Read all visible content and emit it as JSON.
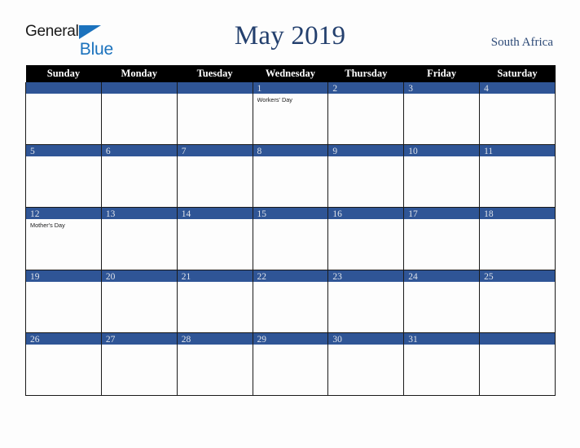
{
  "brand": {
    "word_one": "General",
    "word_two": "Blue",
    "flag_icon": "blue-triangle-flag-icon",
    "accent_color": "#1b72bd"
  },
  "header": {
    "title": "May 2019",
    "region": "South Africa",
    "title_color": "#24406e",
    "region_color": "#2d4a77"
  },
  "colors": {
    "day_header_bg": "#000000",
    "day_header_text": "#ffffff",
    "date_bar_bg": "#2f5596",
    "date_number_text": "#dfe3ea",
    "cell_bg": "#fdfdfd",
    "grid_line": "#1a1a1a",
    "page_bg": "#fdfdfd"
  },
  "weekday_headers": [
    "Sunday",
    "Monday",
    "Tuesday",
    "Wednesday",
    "Thursday",
    "Friday",
    "Saturday"
  ],
  "weeks": [
    [
      {
        "date": "",
        "events": []
      },
      {
        "date": "",
        "events": []
      },
      {
        "date": "",
        "events": []
      },
      {
        "date": "1",
        "events": [
          "Workers' Day"
        ]
      },
      {
        "date": "2",
        "events": []
      },
      {
        "date": "3",
        "events": []
      },
      {
        "date": "4",
        "events": []
      }
    ],
    [
      {
        "date": "5",
        "events": []
      },
      {
        "date": "6",
        "events": []
      },
      {
        "date": "7",
        "events": []
      },
      {
        "date": "8",
        "events": []
      },
      {
        "date": "9",
        "events": []
      },
      {
        "date": "10",
        "events": []
      },
      {
        "date": "11",
        "events": []
      }
    ],
    [
      {
        "date": "12",
        "events": [
          "Mother's Day"
        ]
      },
      {
        "date": "13",
        "events": []
      },
      {
        "date": "14",
        "events": []
      },
      {
        "date": "15",
        "events": []
      },
      {
        "date": "16",
        "events": []
      },
      {
        "date": "17",
        "events": []
      },
      {
        "date": "18",
        "events": []
      }
    ],
    [
      {
        "date": "19",
        "events": []
      },
      {
        "date": "20",
        "events": []
      },
      {
        "date": "21",
        "events": []
      },
      {
        "date": "22",
        "events": []
      },
      {
        "date": "23",
        "events": []
      },
      {
        "date": "24",
        "events": []
      },
      {
        "date": "25",
        "events": []
      }
    ],
    [
      {
        "date": "26",
        "events": []
      },
      {
        "date": "27",
        "events": []
      },
      {
        "date": "28",
        "events": []
      },
      {
        "date": "29",
        "events": []
      },
      {
        "date": "30",
        "events": []
      },
      {
        "date": "31",
        "events": []
      },
      {
        "date": "",
        "events": []
      }
    ]
  ]
}
